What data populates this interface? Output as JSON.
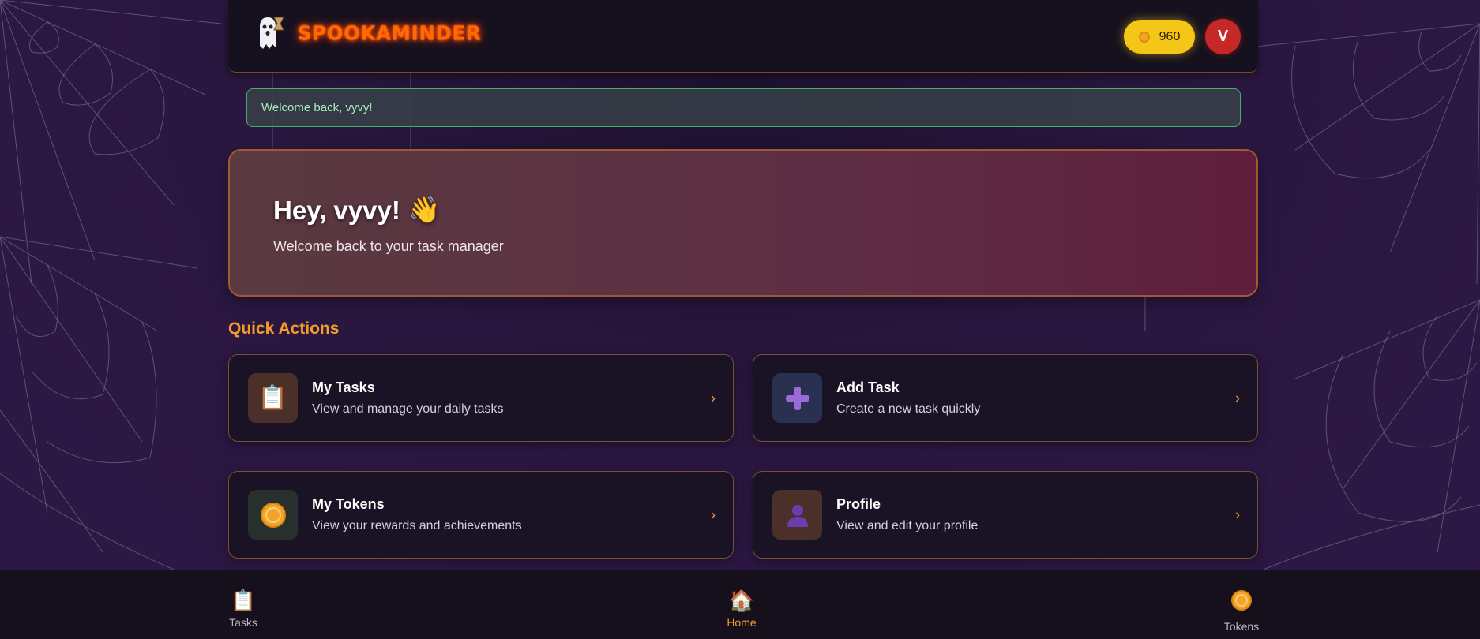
{
  "header": {
    "brand": "SPOOKAMINDER",
    "token_count": "960",
    "avatar_initial": "V"
  },
  "welcome_banner": "Welcome back, vyvy!",
  "hero": {
    "title": "Hey, vyvy!",
    "wave_emoji": "👋",
    "subtitle": "Welcome back to your task manager"
  },
  "quick_actions": {
    "title": "Quick Actions",
    "cards": [
      {
        "icon": "📋",
        "icon_name": "clipboard-icon",
        "title": "My Tasks",
        "subtitle": "View and manage your daily tasks",
        "icon_bg": "#4a3028"
      },
      {
        "icon": "➕",
        "icon_name": "plus-icon",
        "title": "Add Task",
        "subtitle": "Create a new task quickly",
        "icon_bg": "#2a3050"
      },
      {
        "icon": "🪙",
        "icon_name": "coin-icon",
        "title": "My Tokens",
        "subtitle": "View your rewards and achievements",
        "icon_bg": "#28302e"
      },
      {
        "icon": "👤",
        "icon_name": "user-icon",
        "title": "Profile",
        "subtitle": "View and edit your profile",
        "icon_bg": "#4a3028"
      }
    ],
    "arrow": "›"
  },
  "bottom_nav": [
    {
      "icon": "📋",
      "icon_name": "clipboard-icon",
      "label": "Tasks"
    },
    {
      "icon": "🏠",
      "icon_name": "house-icon",
      "label": "Home",
      "active": true
    },
    {
      "icon": "🪙",
      "icon_name": "coin-icon",
      "label": "Tokens"
    }
  ],
  "colors": {
    "accent": "#f39c2b",
    "brand": "#ff6a00",
    "token_pill": "#f5c518",
    "avatar": "#c62828",
    "success_border": "#3fb26a"
  }
}
